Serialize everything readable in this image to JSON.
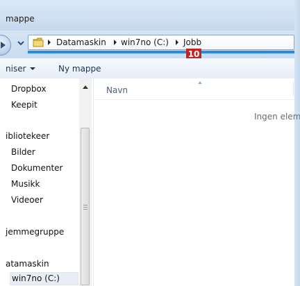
{
  "window": {
    "title": "mappe"
  },
  "address_bar": {
    "breadcrumbs": [
      "Datamaskin",
      "win7no (C:)",
      "Jobb"
    ],
    "progress_percent": 100
  },
  "annotation_badge": "10",
  "command_bar": {
    "organize_label": "niser",
    "new_folder_label": "Ny mappe"
  },
  "nav_pane": {
    "items": [
      {
        "label": "Dropbox"
      },
      {
        "label": "Keepit"
      },
      {
        "label": "ibliotekeer"
      },
      {
        "label": "Bilder"
      },
      {
        "label": "Dokumenter"
      },
      {
        "label": "Musikk"
      },
      {
        "label": "Videoer"
      },
      {
        "label": "jemmegruppe"
      },
      {
        "label": "atamaskin"
      },
      {
        "label": "win7no (C:)",
        "selected": true
      }
    ]
  },
  "content": {
    "column_name": "Navn",
    "empty_message": "Ingen elem"
  }
}
